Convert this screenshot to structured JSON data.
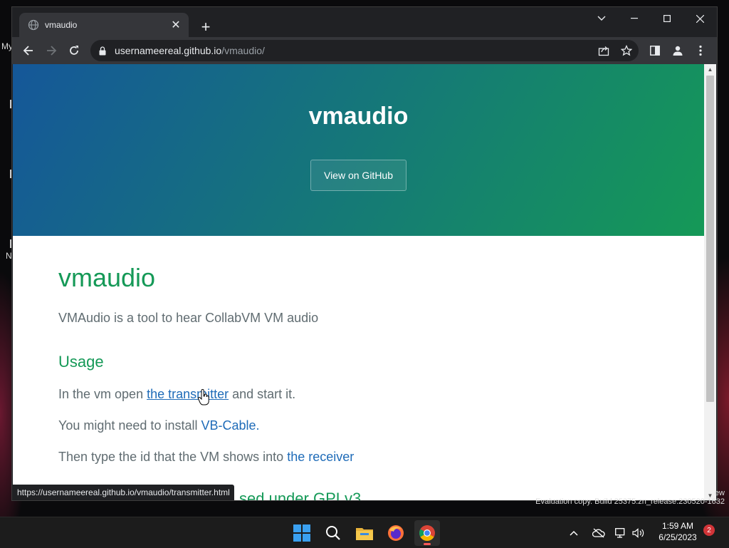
{
  "desktop": {
    "left_labels": [
      "My",
      "N"
    ]
  },
  "browser": {
    "tab": {
      "title": "vmaudio"
    },
    "address": {
      "host": "usernameereal.github.io",
      "path": "/vmaudio/"
    },
    "status_url": "https://usernameereal.github.io/vmaudio/transmitter.html"
  },
  "page": {
    "hero": {
      "title": "vmaudio",
      "button": "View on GitHub"
    },
    "heading": "vmaudio",
    "intro": "VMAudio is a tool to hear CollabVM VM audio",
    "usage_heading": "Usage",
    "line1": {
      "before": "In the vm open ",
      "link": "the transmitter",
      "after": " and start it."
    },
    "line2": {
      "before": "You might need to install ",
      "link": "VB-Cable."
    },
    "line3": {
      "before": "Then type the id that the VM shows into ",
      "link": "the receiver"
    },
    "partial_heading": "sed under GPLv3",
    "colors": {
      "accent": "#159957",
      "link": "#1e6bb8",
      "hero_start": "#155799",
      "hero_end": "#159957"
    }
  },
  "os": {
    "watermark_right": "ew",
    "watermark": "Evaluation copy. Build 25375.zn_release.230520-1632",
    "time": "1:59 AM",
    "date": "6/25/2023",
    "notifications": "2"
  }
}
